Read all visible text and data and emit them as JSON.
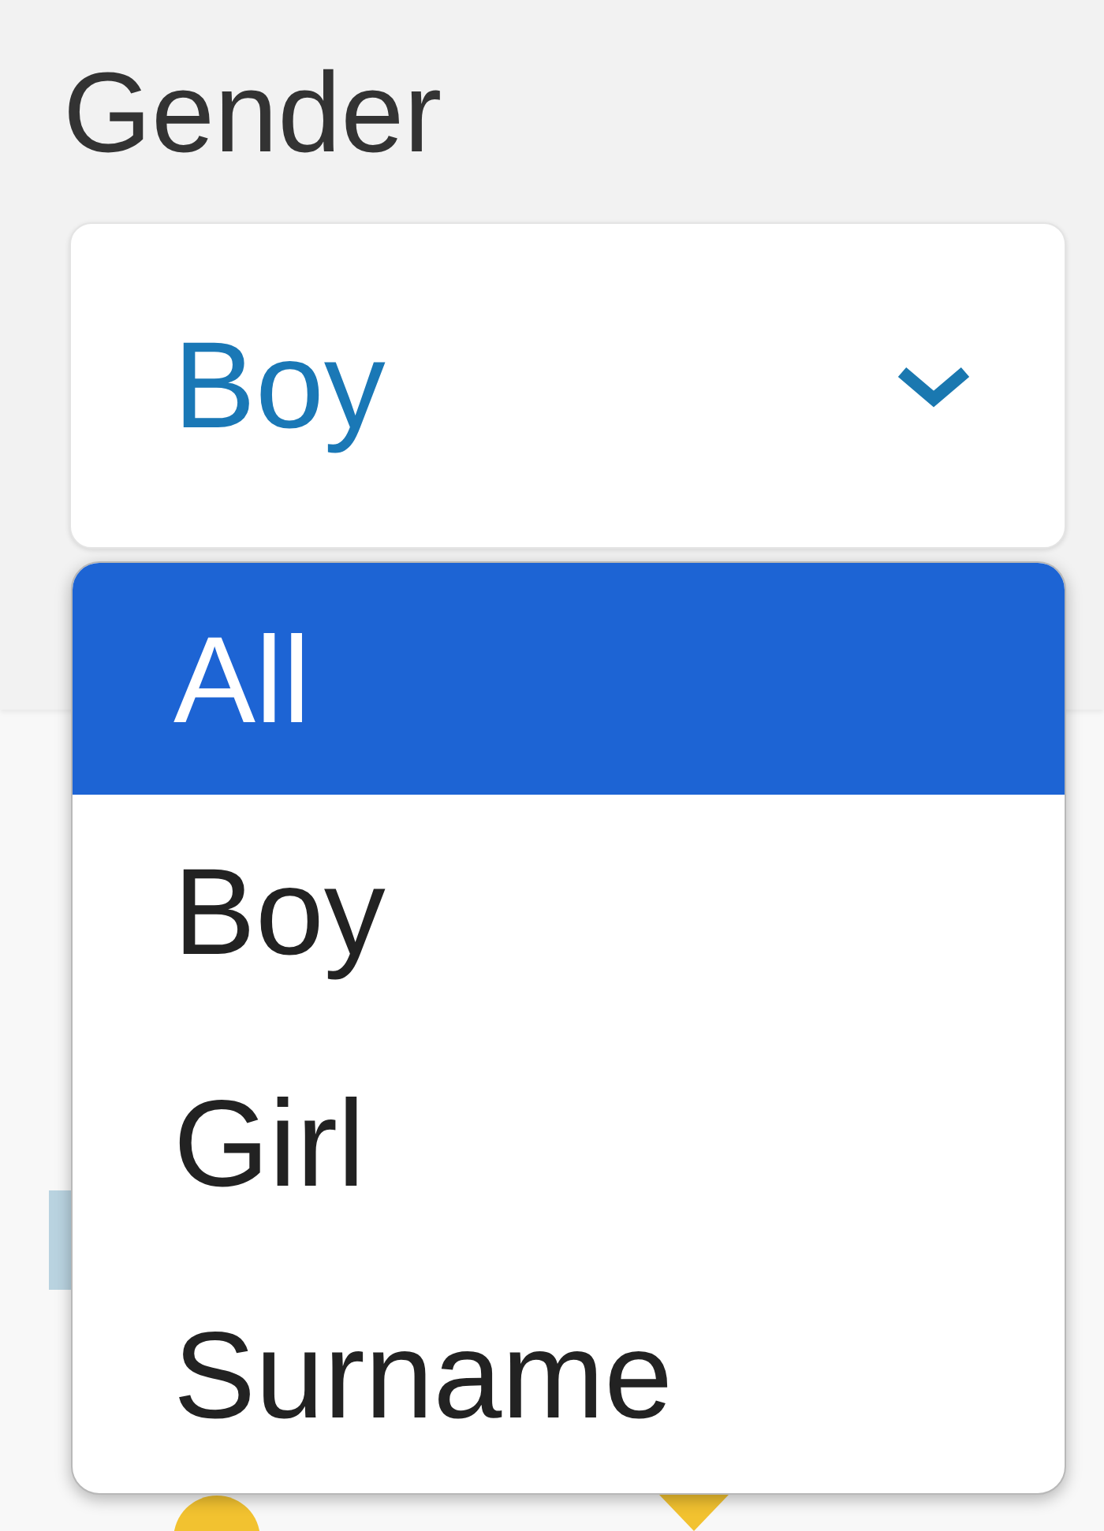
{
  "filter": {
    "label": "Gender",
    "select": {
      "value": "Boy",
      "expanded": true
    },
    "options": [
      {
        "label": "All",
        "selected": true
      },
      {
        "label": "Boy",
        "selected": false
      },
      {
        "label": "Girl",
        "selected": false
      },
      {
        "label": "Surname",
        "selected": false
      }
    ]
  }
}
